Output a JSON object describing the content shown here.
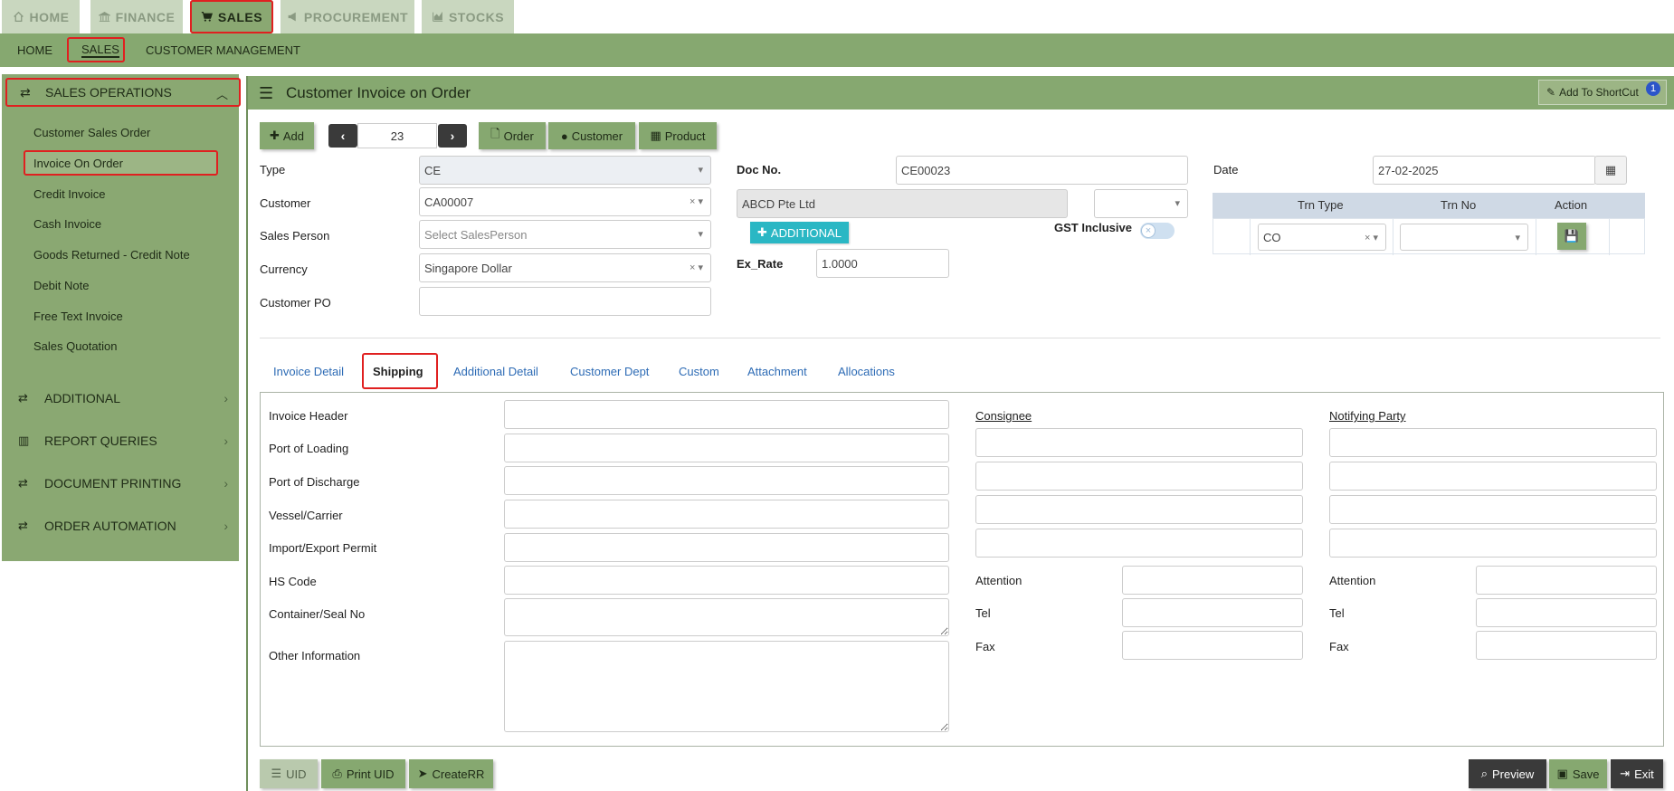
{
  "top_tabs": [
    {
      "label": "HOME",
      "icon": "home-icon"
    },
    {
      "label": "FINANCE",
      "icon": "bank-icon"
    },
    {
      "label": "SALES",
      "icon": "cart-icon",
      "active": true
    },
    {
      "label": "PROCUREMENT",
      "icon": "megaphone-icon"
    },
    {
      "label": "STOCKS",
      "icon": "chart-icon"
    }
  ],
  "subnav": {
    "home": "HOME",
    "sales": "SALES",
    "customer_management": "CUSTOMER MANAGEMENT"
  },
  "sidebar": {
    "sales_operations": "SALES OPERATIONS",
    "items": [
      "Customer Sales Order",
      "Invoice On Order",
      "Credit Invoice",
      "Cash Invoice",
      "Goods Returned - Credit Note",
      "Debit Note",
      "Free Text Invoice",
      "Sales Quotation"
    ],
    "sections": [
      "ADDITIONAL",
      "REPORT QUERIES",
      "DOCUMENT PRINTING",
      "ORDER AUTOMATION"
    ]
  },
  "header": {
    "title": "Customer Invoice on Order",
    "shortcut": "Add To ShortCut",
    "shortcut_badge": "1"
  },
  "toolbar": {
    "add": "Add",
    "record_no": "23",
    "order": "Order",
    "customer": "Customer",
    "product": "Product"
  },
  "form": {
    "type_label": "Type",
    "type_value": "CE",
    "customer_label": "Customer",
    "customer_value": "CA00007",
    "sales_person_label": "Sales Person",
    "sales_person_placeholder": "Select SalesPerson",
    "currency_label": "Currency",
    "currency_value": "Singapore Dollar",
    "customer_po_label": "Customer PO",
    "docno_label": "Doc No.",
    "docno_value": "CE00023",
    "customer_name": "ABCD Pte Ltd",
    "additional": "ADDITIONAL",
    "gst_label": "GST Inclusive",
    "exrate_label": "Ex_Rate",
    "exrate_value": "1.0000",
    "date_label": "Date",
    "date_value": "27-02-2025"
  },
  "trn_table": {
    "headers": [
      "Trn Type",
      "Trn No",
      "Action"
    ],
    "row": {
      "trn_type": "CO",
      "trn_no": ""
    }
  },
  "tabs": [
    "Invoice Detail",
    "Shipping",
    "Additional Detail",
    "Customer Dept",
    "Custom",
    "Attachment",
    "Allocations"
  ],
  "shipping": {
    "labels": [
      "Invoice Header",
      "Port of Loading",
      "Port of Discharge",
      "Vessel/Carrier",
      "Import/Export Permit",
      "HS Code",
      "Container/Seal No",
      "Other Information"
    ],
    "consignee": "Consignee",
    "notifying_party": "Notifying Party",
    "attention": "Attention",
    "tel": "Tel",
    "fax": "Fax"
  },
  "bottom": {
    "uid": "UID",
    "print_uid": "Print UID",
    "create_rr": "CreateRR",
    "preview": "Preview",
    "save": "Save",
    "exit": "Exit"
  },
  "colors": {
    "green": "#86a870",
    "highlight": "#e02020",
    "link": "#2d6bb5",
    "teal": "#2ab7c4"
  }
}
